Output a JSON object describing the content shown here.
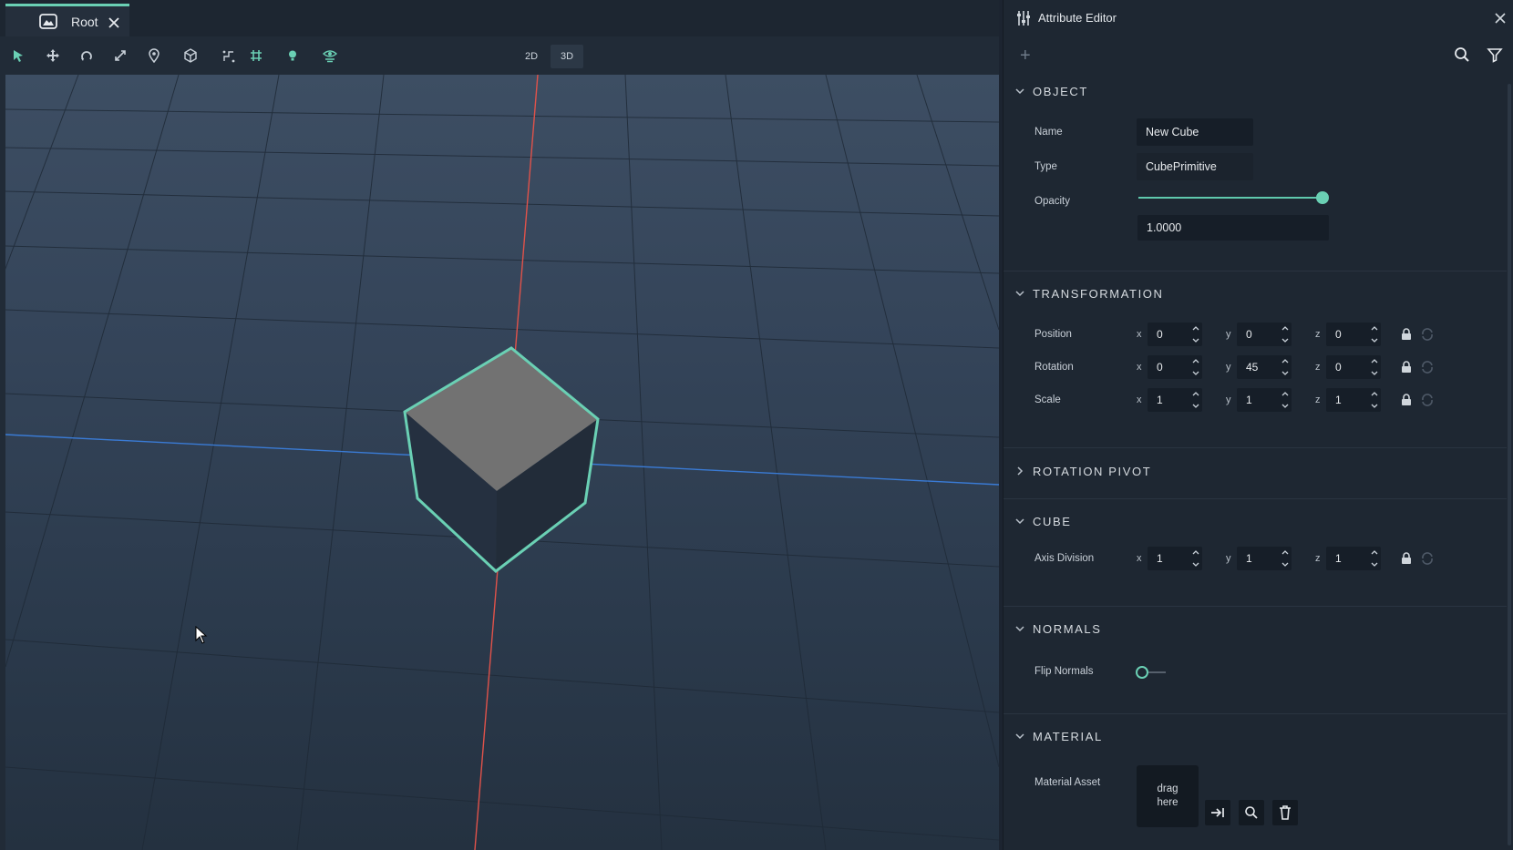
{
  "tab": {
    "label": "Root"
  },
  "view_modes": {
    "mode_2d": "2D",
    "mode_3d": "3D"
  },
  "panel": {
    "title": "Attribute Editor",
    "add_symbol": "+"
  },
  "sections": {
    "object": {
      "title": "OBJECT",
      "name_label": "Name",
      "name_value": "New Cube",
      "type_label": "Type",
      "type_value": "CubePrimitive",
      "opacity_label": "Opacity",
      "opacity_value": "1.0000",
      "opacity_fraction": 1.0
    },
    "transformation": {
      "title": "TRANSFORMATION",
      "position_label": "Position",
      "rotation_label": "Rotation",
      "scale_label": "Scale",
      "position": {
        "x": "0",
        "y": "0",
        "z": "0"
      },
      "rotation": {
        "x": "0",
        "y": "45",
        "z": "0"
      },
      "scale": {
        "x": "1",
        "y": "1",
        "z": "1"
      }
    },
    "rotation_pivot": {
      "title": "ROTATION PIVOT"
    },
    "cube": {
      "title": "CUBE",
      "axis_division_label": "Axis Division",
      "axis_division": {
        "x": "1",
        "y": "1",
        "z": "1"
      }
    },
    "normals": {
      "title": "NORMALS",
      "flip_label": "Flip Normals",
      "flip_on": false
    },
    "material": {
      "title": "MATERIAL",
      "asset_label": "Material Asset",
      "drop_line1": "drag",
      "drop_line2": "here"
    }
  },
  "axis_letters": {
    "x": "x",
    "y": "y",
    "z": "z"
  },
  "colors": {
    "accent": "#6ad0b4",
    "x_axis": "#e0524a",
    "z_axis": "#3a7bd5",
    "cube_top": "#6e6e6e",
    "cube_side": "#27313d"
  }
}
